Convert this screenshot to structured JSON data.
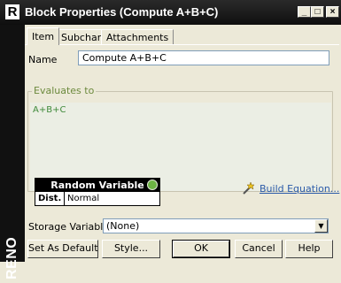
{
  "window": {
    "title": "Block Properties (Compute A+B+C)",
    "app_icon_letter": "R",
    "minimize_glyph": "_",
    "maximize_glyph": "□",
    "close_glyph": "×"
  },
  "sidebar": {
    "brand": "RENO"
  },
  "tabs": [
    "Item",
    "Subchart",
    "Attachments"
  ],
  "active_tab": "Item",
  "name_field": {
    "label": "Name",
    "value": "Compute A+B+C"
  },
  "evaluates": {
    "legend": "Evaluates to",
    "expression": "A+B+C"
  },
  "random_variable": {
    "header": "Random Variable",
    "key": "Dist.",
    "value": "Normal",
    "icon": "globe-icon"
  },
  "build_equation": {
    "label": "Build Equation...",
    "icon": "wand-icon"
  },
  "storage": {
    "label": "Storage Variable",
    "value": "(None)"
  },
  "buttons": {
    "set_default": "Set As Default",
    "style": "Style...",
    "ok": "OK",
    "cancel": "Cancel",
    "help": "Help"
  },
  "colors": {
    "accent_link": "#2a5aa8",
    "expression_text": "#3f8a3a",
    "titlebar": "#1a1a1a"
  }
}
